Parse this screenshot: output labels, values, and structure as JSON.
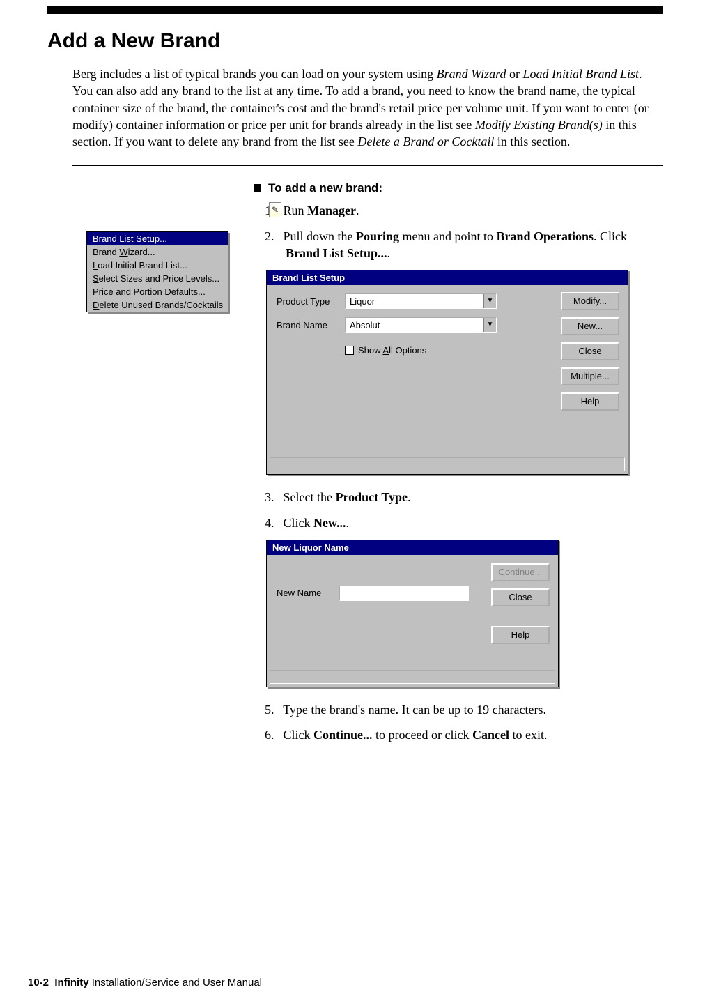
{
  "header": {
    "title": "Add a New Brand"
  },
  "intro": {
    "t1": "Berg includes a list of typical brands you can load on your system using ",
    "i1": "Brand Wizard",
    "t2": " or ",
    "i2": "Load Initial Brand List",
    "t3": ". You can also add any brand to the list at any time. To add a brand, you need to know the brand name, the typical container size of the brand, the container's cost and the brand's retail price per volume unit. If you want to enter (or modify) container information or price per unit for brands already in the list see ",
    "i3": "Modify Existing Brand(s)",
    "t4": " in this section. If you want to delete any brand from the list see ",
    "i4": "Delete a Brand or Cocktail",
    "t5": " in this section."
  },
  "proc_heading": "To add a new brand:",
  "menu": {
    "items": [
      {
        "pre": "",
        "u": "B",
        "post": "rand List Setup...",
        "selected": true
      },
      {
        "pre": "Brand ",
        "u": "W",
        "post": "izard...",
        "selected": false
      },
      {
        "pre": "",
        "u": "L",
        "post": "oad Initial Brand List...",
        "selected": false
      },
      {
        "pre": "",
        "u": "S",
        "post": "elect Sizes and Price Levels...",
        "selected": false
      },
      {
        "pre": "",
        "u": "P",
        "post": "rice and Portion Defaults...",
        "selected": false
      },
      {
        "pre": "",
        "u": "D",
        "post": "elete Unused Brands/Cocktails",
        "selected": false
      }
    ]
  },
  "steps": {
    "s1_pre": "Run ",
    "s1_b": "Manager",
    "s1_post": ".",
    "s2_a": "Pull down the ",
    "s2_b1": "Pouring",
    "s2_c": " menu and point to ",
    "s2_b2": "Brand Operations",
    "s2_d": ". Click ",
    "s2_b3": "Brand List Setup...",
    "s2_e": ".",
    "s3_a": "Select the ",
    "s3_b": "Product Type",
    "s3_c": ".",
    "s4_a": "Click ",
    "s4_b": "New...",
    "s4_c": ".",
    "s5": "Type the brand's name. It can be up to 19 characters.",
    "s6_a": "Click ",
    "s6_b1": "Continue...",
    "s6_c": " to proceed or click ",
    "s6_b2": "Cancel",
    "s6_d": " to exit."
  },
  "dialog1": {
    "title": "Brand List Setup",
    "lbl_product": "Product Type",
    "lbl_brand": "Brand Name",
    "val_product": "Liquor",
    "val_brand": "Absolut",
    "chk_pre": "Show ",
    "chk_u": "A",
    "chk_post": "ll Options",
    "btn_modify_u": "M",
    "btn_modify_post": "odify...",
    "btn_new_u": "N",
    "btn_new_post": "ew...",
    "btn_close": "Close",
    "btn_multiple": "Multiple...",
    "btn_help": "Help"
  },
  "dialog2": {
    "title": "New Liquor Name",
    "lbl_name": "New Name",
    "btn_continue_u": "C",
    "btn_continue_post": "ontinue...",
    "btn_close": "Close",
    "btn_help": "Help"
  },
  "footer": {
    "page": "10-2",
    "title_bold": "Infinity",
    "title_rest": " Installation/Service and User Manual"
  },
  "icons": {
    "pencil": "✎"
  }
}
